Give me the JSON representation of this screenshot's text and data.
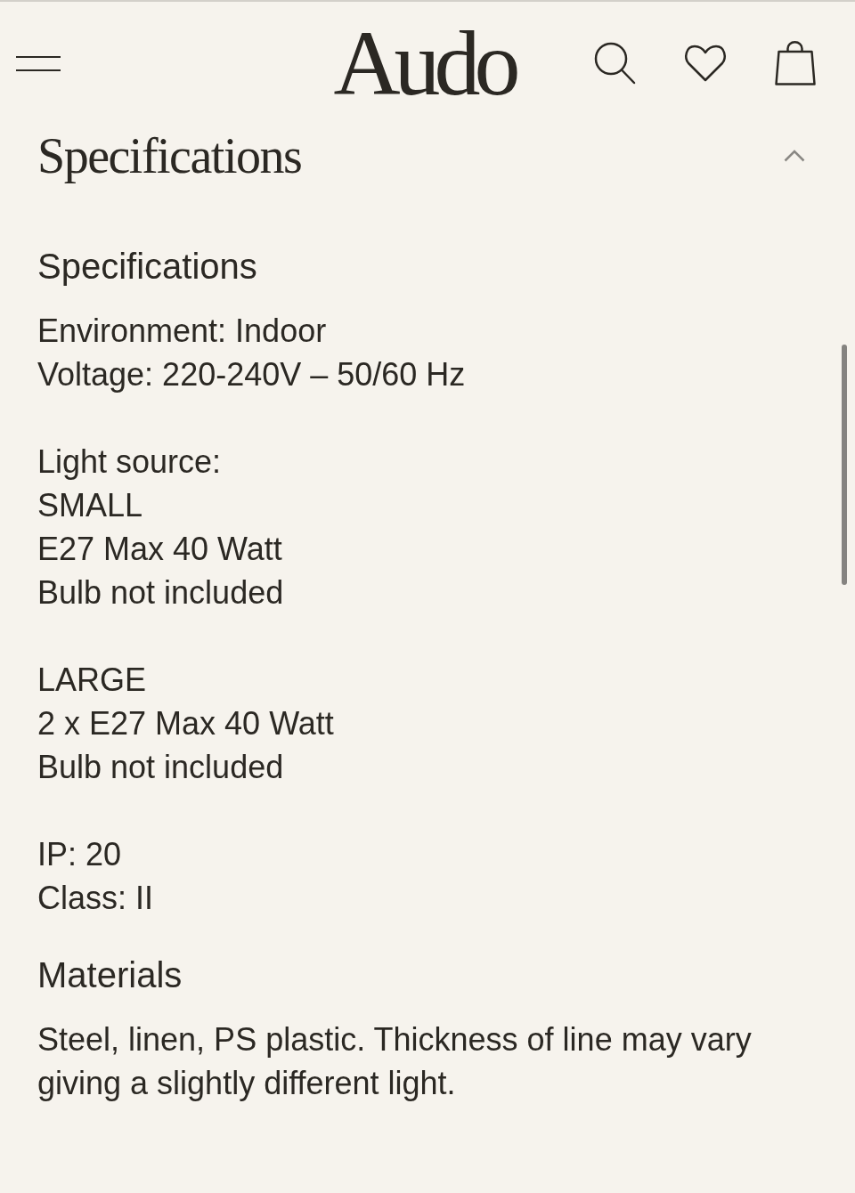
{
  "header": {
    "logo": "Audo"
  },
  "accordion": {
    "title": "Specifications",
    "expanded": true,
    "sections": [
      {
        "heading": "Specifications",
        "groups": [
          [
            "Environment: Indoor",
            "Voltage: 220-240V – 50/60 Hz"
          ],
          [
            "Light source:",
            "SMALL",
            "E27 Max 40 Watt",
            "Bulb not included"
          ],
          [
            "LARGE",
            "2 x E27 Max 40 Watt",
            "Bulb not included"
          ],
          [
            "IP: 20",
            "Class: II"
          ]
        ]
      },
      {
        "heading": "Materials",
        "groups": [
          [
            "Steel, linen, PS plastic. Thickness of line may vary giving a slightly different light."
          ]
        ]
      }
    ]
  }
}
